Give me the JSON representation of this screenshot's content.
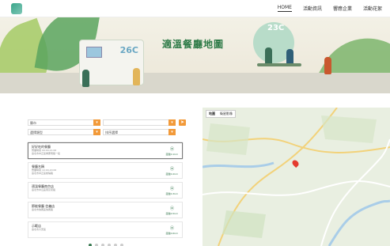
{
  "header": {
    "nav": [
      "HOME",
      "活動資訊",
      "響應企業",
      "活動花絮"
    ]
  },
  "hero": {
    "title": "適溫餐廳地圖",
    "temp_left": "26C",
    "temp_right": "23C"
  },
  "filters": {
    "city_value": "縣市",
    "district_value": "",
    "type_value": "選擇類型",
    "sort_value": "排序選擇"
  },
  "list": {
    "items": [
      {
        "name": "好好吃的餐廳",
        "line1": "營業時間 09:00-21:00",
        "line2": "臺北市中正區重慶南路一段",
        "distance": "距離0.1km"
      },
      {
        "name": "餐廳名稱",
        "line1": "營業時間 10:00-20:00",
        "line2": "臺北市中正區衡陽路",
        "distance": "距離0.2km"
      },
      {
        "name": "適溫餐廳南京店",
        "line1": "臺北市中山區南京東路",
        "line2": "",
        "distance": "距離0.3km"
      },
      {
        "name": "節能餐廳 信義店",
        "line1": "臺北市信義區信義路",
        "line2": "",
        "distance": "距離0.5km"
      },
      {
        "name": "示範店",
        "line1": "臺北市大安區",
        "line2": "",
        "distance": "距離0.6km"
      }
    ],
    "pages": 6,
    "current_page": 1
  },
  "map": {
    "controls": [
      "地圖",
      "衛星影像"
    ]
  }
}
